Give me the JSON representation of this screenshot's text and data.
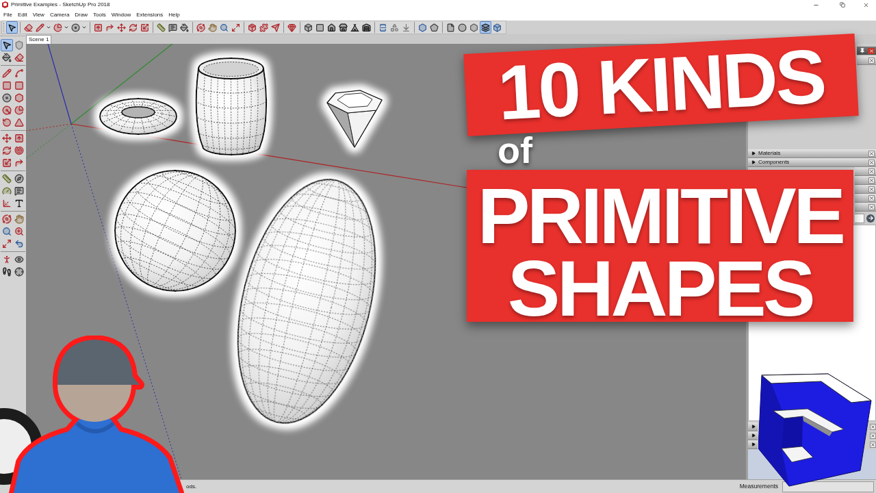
{
  "window": {
    "title": "Primitive Examples - SketchUp Pro 2018"
  },
  "menu": [
    "File",
    "Edit",
    "View",
    "Camera",
    "Draw",
    "Tools",
    "Window",
    "Extensions",
    "Help"
  ],
  "toolbar": {
    "groups": [
      [
        {
          "kind": "button",
          "selected": true
        }
      ],
      [
        {
          "kind": "button",
          "selected": false
        },
        {
          "kind": "dropdown",
          "selected": false
        },
        {
          "kind": "dropdown",
          "selected": false
        },
        {
          "kind": "dropdown",
          "selected": false
        }
      ],
      [
        {
          "kind": "button",
          "selected": false
        },
        {
          "kind": "button",
          "selected": false
        },
        {
          "kind": "button",
          "selected": false
        },
        {
          "kind": "button",
          "selected": false
        },
        {
          "kind": "button",
          "selected": false
        }
      ],
      [
        {
          "kind": "button",
          "selected": false
        },
        {
          "kind": "button",
          "selected": false
        },
        {
          "kind": "button",
          "selected": false
        }
      ],
      [
        {
          "kind": "button",
          "selected": false
        },
        {
          "kind": "button",
          "selected": false
        },
        {
          "kind": "button",
          "selected": false
        },
        {
          "kind": "button",
          "selected": false
        }
      ],
      [
        {
          "kind": "button",
          "selected": false
        },
        {
          "kind": "button",
          "selected": false
        },
        {
          "kind": "button",
          "selected": false
        }
      ],
      [
        {
          "kind": "button",
          "selected": false
        }
      ],
      [
        {
          "kind": "button",
          "selected": false
        },
        {
          "kind": "button",
          "selected": false
        },
        {
          "kind": "button",
          "selected": false
        },
        {
          "kind": "button",
          "selected": false
        },
        {
          "kind": "button",
          "selected": false
        },
        {
          "kind": "button",
          "selected": false
        }
      ],
      [
        {
          "kind": "button",
          "selected": false
        },
        {
          "kind": "button",
          "selected": false
        },
        {
          "kind": "button",
          "selected": false
        }
      ],
      [
        {
          "kind": "button",
          "selected": false
        },
        {
          "kind": "button",
          "selected": false
        }
      ],
      [
        {
          "kind": "button",
          "selected": false
        },
        {
          "kind": "button",
          "selected": false
        },
        {
          "kind": "button",
          "selected": false
        },
        {
          "kind": "button",
          "selected": true
        },
        {
          "kind": "button",
          "selected": false
        }
      ]
    ]
  },
  "scene_tabs": [
    {
      "label": "Scene 1",
      "selected": true
    }
  ],
  "tool_palette": {
    "groups": [
      [
        {
          "selected": true
        },
        {
          "selected": false
        },
        {
          "selected": false
        },
        {
          "selected": false
        }
      ],
      [
        {
          "selected": false
        },
        {
          "selected": false
        },
        {
          "selected": false
        },
        {
          "selected": false
        },
        {
          "selected": false
        },
        {
          "selected": false
        },
        {
          "selected": false
        },
        {
          "selected": false
        },
        {
          "selected": false
        },
        {
          "selected": false
        }
      ],
      [
        {
          "selected": false
        },
        {
          "selected": false
        },
        {
          "selected": false
        },
        {
          "selected": false
        },
        {
          "selected": false
        },
        {
          "selected": false
        }
      ],
      [
        {
          "selected": false
        },
        {
          "selected": false
        },
        {
          "selected": false
        },
        {
          "selected": false
        },
        {
          "selected": false
        },
        {
          "selected": false
        }
      ],
      [
        {
          "selected": false
        },
        {
          "selected": false
        },
        {
          "selected": false
        },
        {
          "selected": false
        },
        {
          "selected": false
        },
        {
          "selected": false
        }
      ],
      [
        {
          "selected": false
        },
        {
          "selected": false
        },
        {
          "selected": false
        },
        {
          "selected": false
        }
      ]
    ]
  },
  "tray": {
    "top_panels": [
      {
        "closable": true
      }
    ],
    "panels": [
      {
        "label": "Materials",
        "expanded": false,
        "closable": true
      },
      {
        "label": "Components",
        "expanded": false,
        "closable": true
      },
      {
        "closable": true
      },
      {
        "closable": true
      },
      {
        "closable": true
      },
      {
        "closable": true
      },
      {
        "closable": true
      }
    ],
    "bottom_panels": [
      {
        "expanded": false,
        "closable": true
      },
      {
        "expanded": false,
        "closable": true
      },
      {
        "expanded": false,
        "closable": true
      }
    ]
  },
  "headline": {
    "line_1": "10 KINDS",
    "connector": "of",
    "line_2": "PRIMITIVE",
    "line_3": "SHAPES"
  },
  "status_bar": {
    "hint": "ods.",
    "measurements_label": "Measurements"
  }
}
